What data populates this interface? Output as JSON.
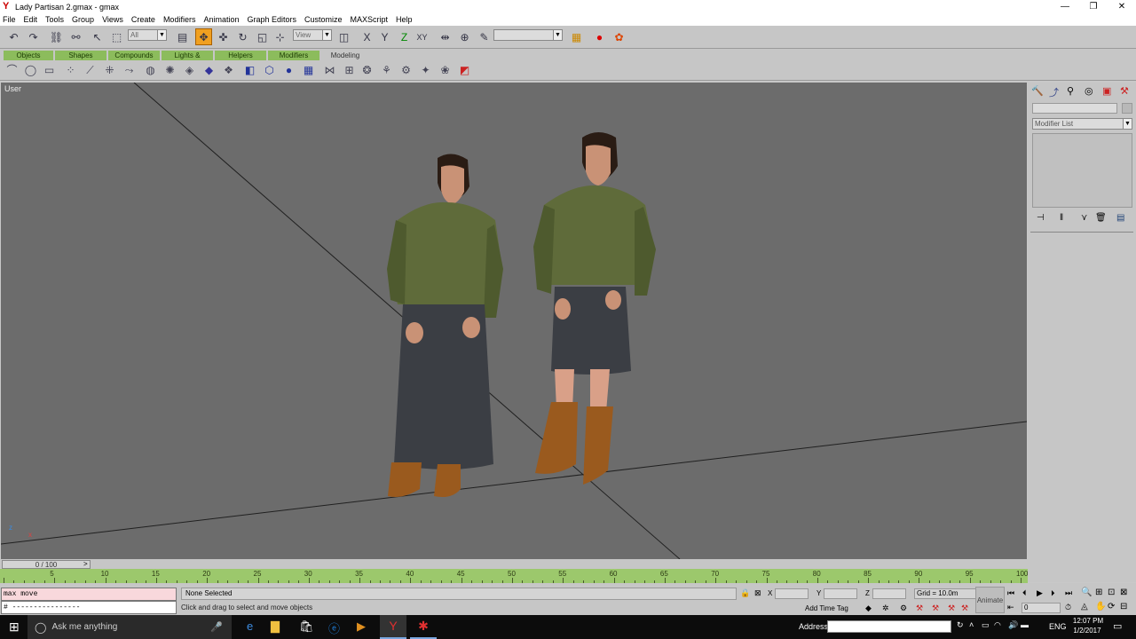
{
  "window": {
    "title": "Lady Partisan 2.gmax - gmax",
    "minimize": "—",
    "maximize": "❐",
    "close": "✕"
  },
  "menu": [
    "File",
    "Edit",
    "Tools",
    "Group",
    "Views",
    "Create",
    "Modifiers",
    "Animation",
    "Graph Editors",
    "Customize",
    "MAXScript",
    "Help"
  ],
  "toolbar": {
    "selection_filter": "All",
    "ref_coord": "View",
    "named_selection": ""
  },
  "tabs": [
    "Objects",
    "Shapes",
    "Compounds",
    "Lights & Cameras",
    "Helpers",
    "Modifiers",
    "Modeling"
  ],
  "viewport": {
    "label": "User",
    "axis_x": "x",
    "axis_z": "z"
  },
  "command_panel": {
    "name_field": "",
    "modifier_list": "Modifier List"
  },
  "timeline": {
    "frame_display": "0 / 100",
    "ticks": [
      "5",
      "10",
      "15",
      "20",
      "25",
      "30",
      "35",
      "40",
      "45",
      "50",
      "55",
      "60",
      "65",
      "70",
      "75",
      "80",
      "85",
      "90",
      "95",
      "100"
    ]
  },
  "status": {
    "maxscript_line1": "max move",
    "maxscript_line2": "# ----------------",
    "selection": "None Selected",
    "prompt": "Click and drag to select and move objects",
    "x_label": "X",
    "y_label": "Y",
    "z_label": "Z",
    "grid": "Grid = 10.0m",
    "add_time_tag": "Add Time Tag",
    "animate": "Animate",
    "frame": "0"
  },
  "taskbar": {
    "search_placeholder": "Ask me anything",
    "address_label": "Address",
    "lang": "ENG",
    "time": "12:07 PM",
    "date": "1/2/2017"
  }
}
